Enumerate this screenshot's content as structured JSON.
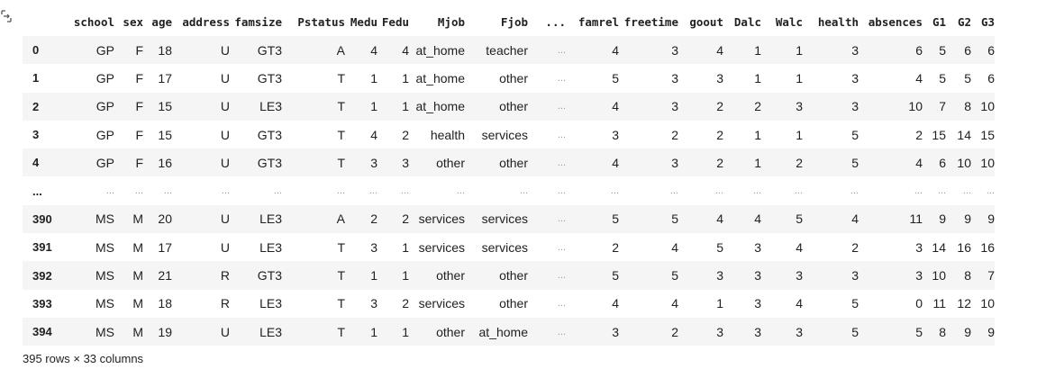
{
  "columns": [
    "school",
    "sex",
    "age",
    "address",
    "famsize",
    "Pstatus",
    "Medu",
    "Fedu",
    "Mjob",
    "Fjob",
    "...",
    "famrel",
    "freetime",
    "goout",
    "Dalc",
    "Walc",
    "health",
    "absences",
    "G1",
    "G2",
    "G3"
  ],
  "rows": [
    {
      "index": "0",
      "cells": [
        "GP",
        "F",
        "18",
        "U",
        "GT3",
        "A",
        "4",
        "4",
        "at_home",
        "teacher",
        "...",
        "4",
        "3",
        "4",
        "1",
        "1",
        "3",
        "6",
        "5",
        "6",
        "6"
      ]
    },
    {
      "index": "1",
      "cells": [
        "GP",
        "F",
        "17",
        "U",
        "GT3",
        "T",
        "1",
        "1",
        "at_home",
        "other",
        "...",
        "5",
        "3",
        "3",
        "1",
        "1",
        "3",
        "4",
        "5",
        "5",
        "6"
      ]
    },
    {
      "index": "2",
      "cells": [
        "GP",
        "F",
        "15",
        "U",
        "LE3",
        "T",
        "1",
        "1",
        "at_home",
        "other",
        "...",
        "4",
        "3",
        "2",
        "2",
        "3",
        "3",
        "10",
        "7",
        "8",
        "10"
      ]
    },
    {
      "index": "3",
      "cells": [
        "GP",
        "F",
        "15",
        "U",
        "GT3",
        "T",
        "4",
        "2",
        "health",
        "services",
        "...",
        "3",
        "2",
        "2",
        "1",
        "1",
        "5",
        "2",
        "15",
        "14",
        "15"
      ]
    },
    {
      "index": "4",
      "cells": [
        "GP",
        "F",
        "16",
        "U",
        "GT3",
        "T",
        "3",
        "3",
        "other",
        "other",
        "...",
        "4",
        "3",
        "2",
        "1",
        "2",
        "5",
        "4",
        "6",
        "10",
        "10"
      ]
    },
    {
      "index": "...",
      "cells": [
        "...",
        "...",
        "...",
        "...",
        "...",
        "...",
        "...",
        "...",
        "...",
        "...",
        "...",
        "...",
        "...",
        "...",
        "...",
        "...",
        "...",
        "...",
        "...",
        "...",
        "..."
      ]
    },
    {
      "index": "390",
      "cells": [
        "MS",
        "M",
        "20",
        "U",
        "LE3",
        "A",
        "2",
        "2",
        "services",
        "services",
        "...",
        "5",
        "5",
        "4",
        "4",
        "5",
        "4",
        "11",
        "9",
        "9",
        "9"
      ]
    },
    {
      "index": "391",
      "cells": [
        "MS",
        "M",
        "17",
        "U",
        "LE3",
        "T",
        "3",
        "1",
        "services",
        "services",
        "...",
        "2",
        "4",
        "5",
        "3",
        "4",
        "2",
        "3",
        "14",
        "16",
        "16"
      ]
    },
    {
      "index": "392",
      "cells": [
        "MS",
        "M",
        "21",
        "R",
        "GT3",
        "T",
        "1",
        "1",
        "other",
        "other",
        "...",
        "5",
        "5",
        "3",
        "3",
        "3",
        "3",
        "3",
        "10",
        "8",
        "7"
      ]
    },
    {
      "index": "393",
      "cells": [
        "MS",
        "M",
        "18",
        "R",
        "LE3",
        "T",
        "3",
        "2",
        "services",
        "other",
        "...",
        "4",
        "4",
        "1",
        "3",
        "4",
        "5",
        "0",
        "11",
        "12",
        "10"
      ]
    },
    {
      "index": "394",
      "cells": [
        "MS",
        "M",
        "19",
        "U",
        "LE3",
        "T",
        "1",
        "1",
        "other",
        "at_home",
        "...",
        "3",
        "2",
        "3",
        "3",
        "3",
        "5",
        "5",
        "8",
        "9",
        "9"
      ]
    }
  ],
  "footer": "395 rows × 33 columns",
  "icons": {
    "output": "output-expand-icon"
  },
  "colors": {
    "stripe": "#f5f5f5",
    "text": "#212121"
  }
}
